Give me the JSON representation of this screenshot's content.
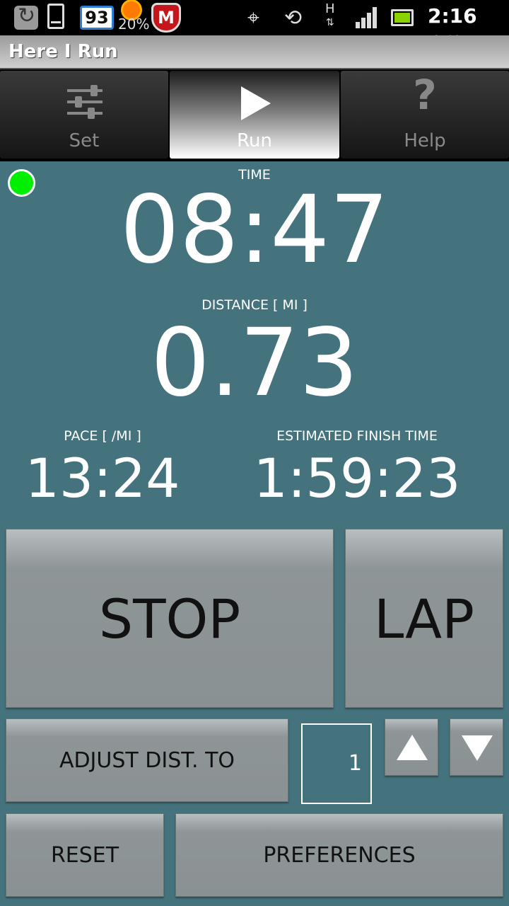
{
  "status_bar": {
    "temperature": "93",
    "weather_percent": "20%",
    "mcafee_letter": "M",
    "network_type": "H",
    "clock": "2:16 pm",
    "icons": [
      "sync-icon",
      "phone-icon",
      "temperature-icon",
      "weather-sun-icon",
      "mcafee-icon",
      "gps-icon",
      "rotate-icon",
      "network-h-icon",
      "signal-icon",
      "battery-icon"
    ]
  },
  "app": {
    "title": "Here I Run"
  },
  "tabs": [
    {
      "label": "Set",
      "icon": "sliders-icon",
      "active": false
    },
    {
      "label": "Run",
      "icon": "play-icon",
      "active": true
    },
    {
      "label": "Help",
      "icon": "help-icon",
      "active": false
    }
  ],
  "gps_status_color": "#00ee00",
  "time": {
    "label": "TIME",
    "value": "08:47"
  },
  "distance": {
    "label": "DISTANCE [ MI ]",
    "value": "0.73"
  },
  "pace": {
    "label": "PACE [ /MI ]",
    "value": "13:24"
  },
  "estimated_finish": {
    "label": "ESTIMATED FINISH TIME",
    "value": "1:59:23"
  },
  "buttons": {
    "stop": "STOP",
    "lap": "LAP",
    "adjust": "ADJUST DIST. TO",
    "adjust_value": "1",
    "reset": "RESET",
    "preferences": "PREFERENCES"
  },
  "colors": {
    "background": "#45737d",
    "button": "#8e9597",
    "gps_dot": "#00ee00"
  }
}
